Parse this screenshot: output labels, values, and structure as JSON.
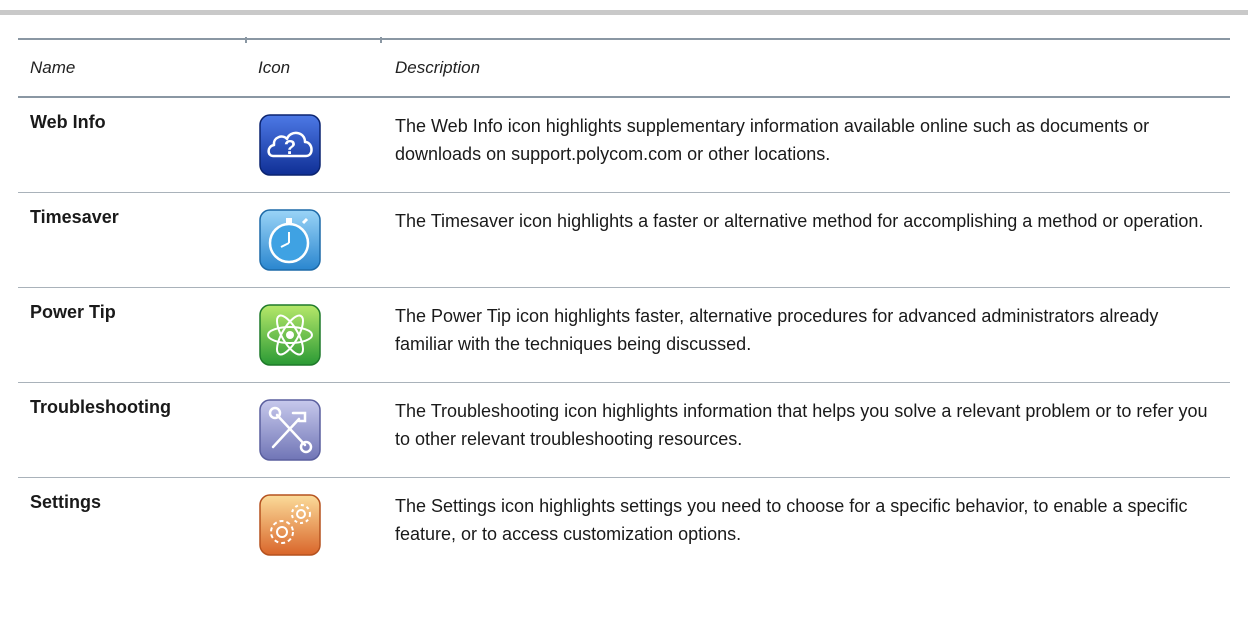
{
  "table": {
    "headers": {
      "name": "Name",
      "icon": "Icon",
      "description": "Description"
    },
    "rows": [
      {
        "name": "Web Info",
        "icon": "web-info-cloud-question-icon",
        "description": "The Web Info icon highlights supplementary information available online such as documents or downloads on support.polycom.com or other locations."
      },
      {
        "name": "Timesaver",
        "icon": "timesaver-stopwatch-icon",
        "description": "The Timesaver icon highlights a faster or alternative method for accomplishing a method or operation."
      },
      {
        "name": "Power Tip",
        "icon": "power-tip-atom-icon",
        "description": "The Power Tip icon highlights faster, alternative procedures for advanced administrators already familiar with the techniques being discussed."
      },
      {
        "name": "Troubleshooting",
        "icon": "troubleshooting-tools-icon",
        "description": "The Troubleshooting icon highlights information that helps you solve a relevant problem or to refer you to other relevant troubleshooting resources."
      },
      {
        "name": "Settings",
        "icon": "settings-gears-icon",
        "description": "The Settings icon highlights settings you need to choose for a specific behavior, to enable a specific feature, or to access customization options."
      }
    ]
  },
  "colors": {
    "rule": "#8a97a3",
    "web_info": "#1f45b5",
    "timesaver": "#4aa3e0",
    "power_tip": "#3fae3a",
    "troubleshooting": "#8f93c9",
    "settings": "#e88a3a"
  }
}
